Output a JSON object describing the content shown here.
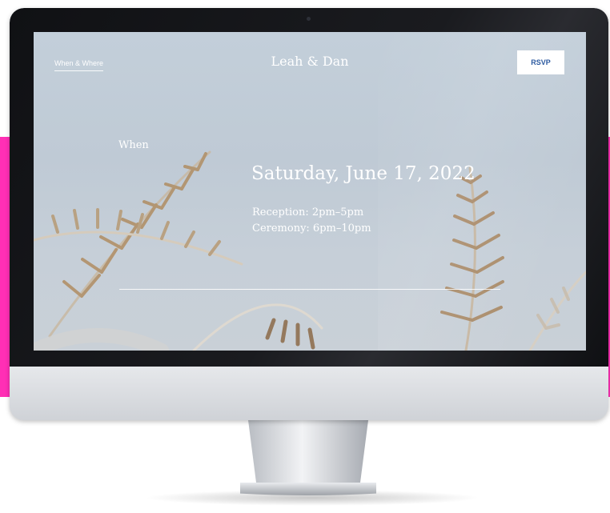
{
  "colors": {
    "accent_band": "#ff2fb5",
    "rsvp_text": "#2c5aa0",
    "screen_background": "#c3cfda",
    "fern": "#b08d62"
  },
  "nav": {
    "link_label": "When & Where"
  },
  "header": {
    "site_title": "Leah & Dan",
    "rsvp_label": "RSVP"
  },
  "section": {
    "label": "When",
    "date": "Saturday, June 17, 2022",
    "lines": [
      "Reception: 2pm–5pm",
      "Ceremony: 6pm–10pm"
    ]
  },
  "icons": {
    "background_image": "fern-photo"
  }
}
